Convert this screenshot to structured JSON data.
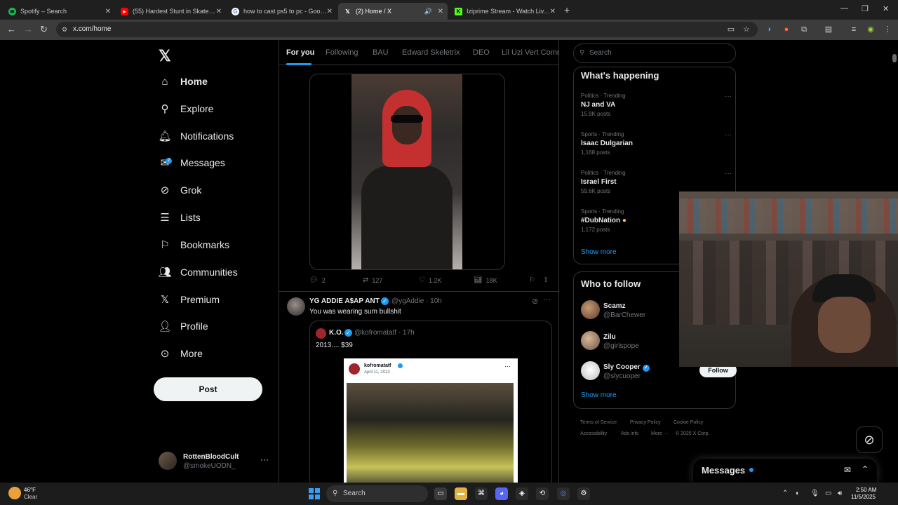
{
  "browser": {
    "tabs": [
      {
        "title": "Spotify – Search",
        "color": "#1db954",
        "icon": "spotify-icon"
      },
      {
        "title": "(55) Hardest Stunt in Skate 4 #...",
        "color": "#ff0000",
        "icon": "youtube-icon"
      },
      {
        "title": "how to cast ps5 to pc - Google...",
        "color": "#4285f4",
        "icon": "google-icon"
      },
      {
        "title": "(2) Home / X",
        "color": "#000000",
        "icon": "x-icon"
      },
      {
        "title": "Iziprime Stream - Watch Live o...",
        "color": "#53fc18",
        "icon": "kick-icon"
      }
    ],
    "url": "x.com/home"
  },
  "nav": {
    "items": [
      {
        "label": "Home",
        "icon": "home-icon"
      },
      {
        "label": "Explore",
        "icon": "search-icon"
      },
      {
        "label": "Notifications",
        "icon": "bell-icon"
      },
      {
        "label": "Messages",
        "icon": "envelope-icon",
        "badge": "2"
      },
      {
        "label": "Grok",
        "icon": "grok-icon"
      },
      {
        "label": "Lists",
        "icon": "list-icon"
      },
      {
        "label": "Bookmarks",
        "icon": "bookmark-icon"
      },
      {
        "label": "Communities",
        "icon": "people-icon"
      },
      {
        "label": "Premium",
        "icon": "x-premium-icon"
      },
      {
        "label": "Profile",
        "icon": "person-icon"
      },
      {
        "label": "More",
        "icon": "more-circle-icon"
      }
    ],
    "post_label": "Post",
    "account": {
      "name": "RottenBloodCult",
      "handle": "@smokeUODN_"
    }
  },
  "feed": {
    "tabs": [
      "For you",
      "Following",
      "BAU",
      "Edward Skeletrix",
      "DEO",
      "Lil Uzi Vert Comm"
    ],
    "post1": {
      "replies": "2",
      "reposts": "127",
      "likes": "1.2K",
      "views": "18K"
    },
    "post2": {
      "name": "YG ADDIE A$AP ANT",
      "handle_time": "@ygAddie · 10h",
      "text": "You was wearing sum bullshit",
      "quote": {
        "name": "K.O.",
        "handle_time": "@kofromatatf · 17h",
        "text": "2013.... $39",
        "image_name": "kofromatatf",
        "image_date": "April 11, 2013"
      }
    }
  },
  "sidebar": {
    "search_placeholder": "Search",
    "happening_title": "What's happening",
    "trends": [
      {
        "meta": "Politics · Trending",
        "name": "NJ and VA",
        "posts": "15.9K posts"
      },
      {
        "meta": "Sports · Trending",
        "name": "Isaac Dulgarian",
        "posts": "1,168 posts"
      },
      {
        "meta": "Politics · Trending",
        "name": "Israel First",
        "posts": "59.6K posts"
      },
      {
        "meta": "Sports · Trending",
        "name": "#DubNation",
        "posts": "1,172 posts"
      }
    ],
    "show_more": "Show more",
    "follow_title": "Who to follow",
    "follow": [
      {
        "name": "Scamz",
        "handle": "@BarChewer"
      },
      {
        "name": "Zilu",
        "handle": "@girlspope"
      },
      {
        "name": "Sly Cooper",
        "handle": "@slycuoper",
        "verified": true,
        "button": "Follow"
      }
    ],
    "footer": [
      "Terms of Service",
      "Privacy Policy",
      "Cookie Policy",
      "Accessibility",
      "Ads info",
      "More ···",
      "© 2025 X Corp."
    ]
  },
  "messages_drawer": {
    "title": "Messages"
  },
  "taskbar": {
    "weather_temp": "46°F",
    "weather_cond": "Clear",
    "search_label": "Search",
    "time": "2:50 AM",
    "date": "11/5/2025"
  }
}
